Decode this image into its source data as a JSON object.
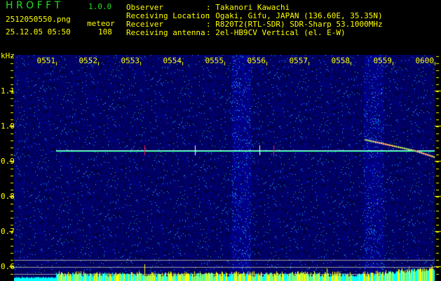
{
  "header": {
    "app_title": "H R O F F T",
    "app_version": "1.0.0",
    "filename": "2512050550.png",
    "datetime": "25.12.05 05:50",
    "mode_label": "meteor",
    "meteor_count": "108",
    "info": [
      {
        "label": "Observer",
        "value": ": Takanori Kawachi"
      },
      {
        "label": "Receiving Location",
        "value": ": Ogaki, Gifu, JAPAN (136.60E, 35.35N)"
      },
      {
        "label": "Receiver",
        "value": ": R820T2(RTL-SDR) SDR-Sharp 53.1000MHz"
      },
      {
        "label": "Receiving antenna",
        "value": ": 2el-HB9CV Vertical (el. E-W)"
      }
    ]
  },
  "spectrogram": {
    "freq_unit": "kHz",
    "time_labels": [
      "0551",
      "0552",
      "0553",
      "0554",
      "0555",
      "0556",
      "0557",
      "0558",
      "0559",
      "0600"
    ],
    "freq_labels": [
      "1.1",
      "1.0",
      "0.9",
      "0.8",
      "0.7",
      "0.6"
    ],
    "colors": {
      "background": "#000000",
      "noise": "#1020c0",
      "text": "#ffff00",
      "title": "#22dd22",
      "carrier": "#ffffff",
      "meteor": "#ff2080",
      "level_low": "#00ffff",
      "level_high": "#ffff00"
    }
  }
}
